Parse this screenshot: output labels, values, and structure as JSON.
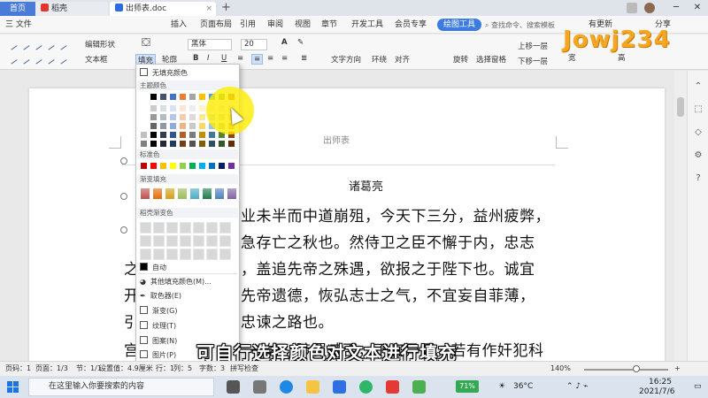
{
  "tabs": {
    "home": "首页",
    "daoke": "稻壳",
    "doc": "出师表.doc"
  },
  "menu": {
    "file": "三 文件",
    "items": [
      "插入",
      "页面布局",
      "引用",
      "审阅",
      "视图",
      "章节",
      "开发工具",
      "会员专享",
      "绘图工具"
    ],
    "search": "查找命令、搜索模板",
    "update": "有更新",
    "share": "分享"
  },
  "ribbon": {
    "edit_shape": "编辑形状",
    "textbox": "文本框",
    "fill": "填充",
    "outline": "轮廓",
    "font": "黑体",
    "size": "20",
    "text_dir": "文字方向",
    "wrap": "环绕",
    "align": "对齐",
    "rotate": "旋转",
    "select_pane": "选择窗格",
    "up_one": "上移一层",
    "down_one": "下移一层",
    "width_label": "宽",
    "height_label": "高"
  },
  "dropdown": {
    "no_fill": "无填充颜色",
    "theme": "主题颜色",
    "standard": "标准色",
    "gradient": "渐变填充",
    "daoke_gradient": "稻壳渐变色",
    "auto": "自动",
    "more": "其他填充颜色(M)...",
    "picker": "取色器(E)",
    "gradient_item": "渐变(G)",
    "texture": "纹理(T)",
    "pattern": "图案(N)",
    "picture": "图片(P)",
    "theme_top": [
      "#ffffff",
      "#000000",
      "#44546a",
      "#4472c4",
      "#ed7d31",
      "#a5a5a5",
      "#ffc000",
      "#5b9bd5",
      "#70ad47",
      "#c55a11"
    ],
    "standard_colors": [
      "#c00000",
      "#ff0000",
      "#ffc000",
      "#ffff00",
      "#92d050",
      "#00b050",
      "#00b0f0",
      "#0070c0",
      "#002060",
      "#7030a0"
    ],
    "gradient_colors": [
      "#c0504d",
      "#e36c09",
      "#d4a017",
      "#9bbb59",
      "#4bacc6",
      "#1f7a4d",
      "#4f81bd",
      "#8064a2"
    ]
  },
  "document": {
    "header": "出师表",
    "author": "诸葛亮",
    "lines": [
      "业未半而中道崩殂，今天下三分，益州疲弊，",
      "急存亡之秋也。然侍卫之臣不懈于内，忠志",
      "，盖追先帝之殊遇，欲报之于陛下也。诚宜",
      "先帝遗德，恢弘志士之气，不宜妄自菲薄，",
      "忠谏之路也。",
      "一体，陟罚臧否，不宜异同。若有作奸犯科"
    ],
    "left_fragments": [
      "之",
      "开",
      "引",
      "宫"
    ]
  },
  "caption": "可自行选择颜色对文本进行填充",
  "logo": "Jowj234",
  "status": {
    "page": "页码：1",
    "pages": "页面：1/3",
    "section": "节：1/1",
    "setting": "设置值：4.9厘米",
    "row": "行：1",
    "col": "列：5",
    "words": "字数：3",
    "spell": "拼写检查",
    "zoom": "140%"
  },
  "taskbar": {
    "search": "在这里输入你要搜索的内容",
    "battery": "71%",
    "temp": "36°C",
    "time": "16:25",
    "date": "2021/7/6"
  }
}
